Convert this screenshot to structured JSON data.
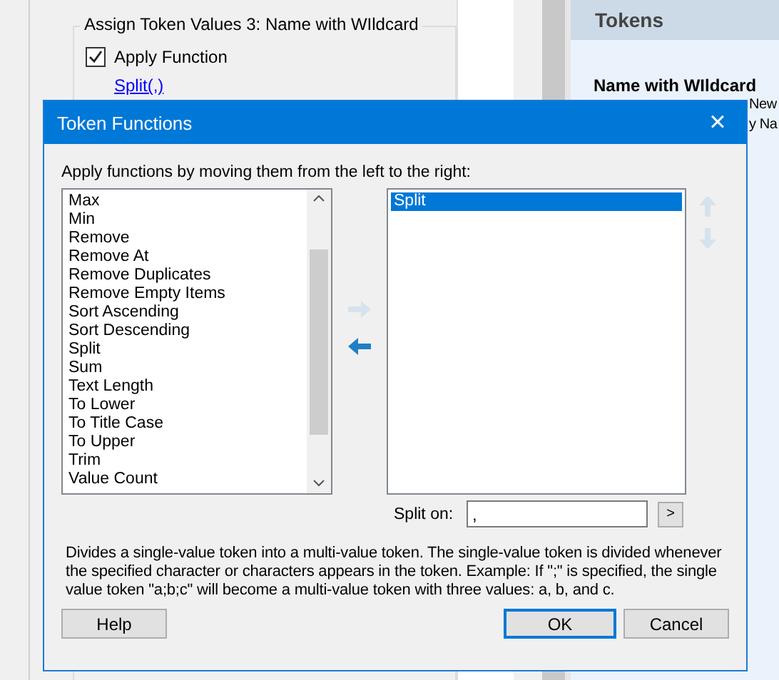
{
  "background": {
    "group_title": "Assign Token Values 3: Name with WIldcard",
    "apply_function": {
      "label": "Apply Function",
      "checked": true
    },
    "function_link": "Split(,)",
    "tokens_panel": {
      "title": "Tokens",
      "heading": "Name with WIldcard",
      "lines": [
        "New",
        "y Na"
      ]
    }
  },
  "dialog": {
    "title": "Token Functions",
    "close": "×",
    "instruction": "Apply functions by moving them from the left to the right:",
    "available": [
      {
        "label": "Max",
        "selected": false
      },
      {
        "label": "Min",
        "selected": false
      },
      {
        "label": "Remove",
        "selected": false
      },
      {
        "label": "Remove At",
        "selected": false
      },
      {
        "label": "Remove Duplicates",
        "selected": false
      },
      {
        "label": "Remove Empty Items",
        "selected": false
      },
      {
        "label": "Sort Ascending",
        "selected": false
      },
      {
        "label": "Sort Descending",
        "selected": false
      },
      {
        "label": "Split",
        "selected": false
      },
      {
        "label": "Sum",
        "selected": false
      },
      {
        "label": "Text Length",
        "selected": false
      },
      {
        "label": "To Lower",
        "selected": false
      },
      {
        "label": "To Title Case",
        "selected": false
      },
      {
        "label": "To Upper",
        "selected": false
      },
      {
        "label": "Trim",
        "selected": false
      },
      {
        "label": "Value Count",
        "selected": false
      }
    ],
    "add_enabled": false,
    "remove_enabled": true,
    "move_up_enabled": false,
    "move_down_enabled": false,
    "applied": [
      {
        "label": "Split",
        "selected": true
      }
    ],
    "split_on": {
      "label": "Split on:",
      "value": ",",
      "button": ">"
    },
    "description": "Divides a single-value token into a multi-value token. The single-value token is divided whenever the specified character or characters appears in the token. Example: If \";\" is specified, the single value token \"a;b;c\" will become a multi-value token with three values: a, b, and c.",
    "buttons": {
      "help": "Help",
      "ok": "OK",
      "cancel": "Cancel"
    }
  }
}
